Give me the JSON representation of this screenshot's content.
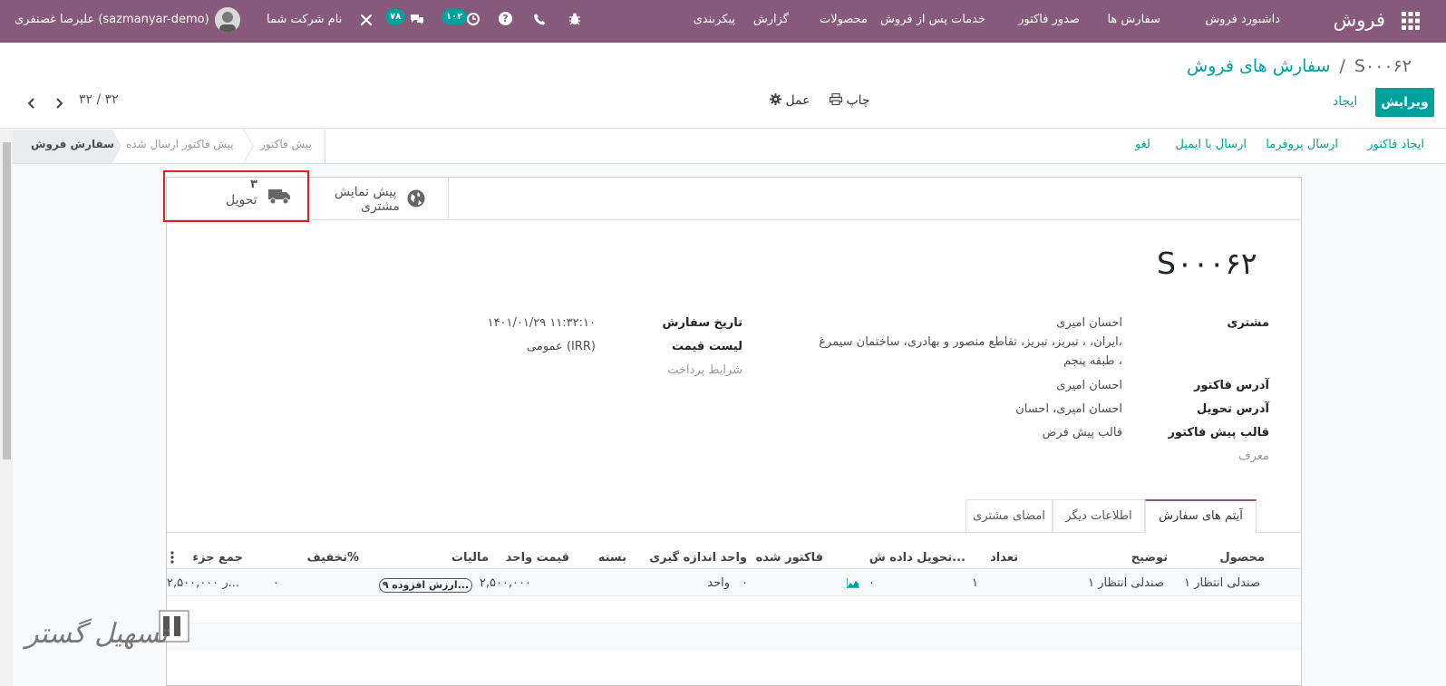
{
  "navbar": {
    "brand": "فروش",
    "menu": [
      "داشبورد فروش",
      "سفارش ها",
      "صدور فاکتور",
      "خدمات پس از فروش",
      "محصولات",
      "گزارش",
      "پیکربندی"
    ],
    "company": "نام شرکت شما",
    "user": "علیرضا غضنفری (sazmanyar-demo)",
    "messages_count": "۷۸",
    "activities_count": "۱۰۲",
    "help_icon": "?"
  },
  "breadcrumb": {
    "parent": "سفارش های فروش",
    "separator": "/",
    "current": "S۰۰۰۶۲"
  },
  "actions": {
    "edit": "ویرایش",
    "create": "ایجاد",
    "print": "چاپ",
    "action": "عمل"
  },
  "pager": {
    "text": "۳۲ / ۳۲"
  },
  "header_buttons": [
    "ایجاد فاکتور",
    "ارسال پروفرما",
    "ارسال با ایمیل",
    "لغو"
  ],
  "status_stages": [
    "سفارش فروش",
    "پیش فاکتور ارسال شده",
    "پیش فاکتور"
  ],
  "smart_buttons": {
    "delivery": {
      "count": "۳",
      "label": "تحویل"
    },
    "preview": {
      "line1": "پیش نمایش",
      "line2": "مشتری"
    }
  },
  "record": {
    "name": "S۰۰۰۶۲",
    "fields_right": {
      "customer_label": "مشتری",
      "customer_name": "احسان امیری",
      "customer_address_1": "ایران، ، تبریز، تبریز، تقاطع منصور و بهادری، ساختمان سیمرغ،",
      "customer_address_2": "طبقه پنجم ،",
      "invoice_address_label": "آدرس فاکتور",
      "invoice_address": "احسان امیری",
      "delivery_address_label": "آدرس تحویل",
      "delivery_address": "احسان امیری، احسان",
      "quote_template_label": "قالب پیش فاکتور",
      "quote_template": "قالب پیش فرض",
      "referrer_label": "معرف"
    },
    "fields_left": {
      "order_date_label": "تاریخ سفارش",
      "order_date": "۱۴۰۱/۰۱/۲۹ ۱۱:۳۲:۱۰",
      "pricelist_label": "لیست قیمت",
      "pricelist": "عمومی (IRR)",
      "payment_terms_label": "شرایط پرداخت"
    }
  },
  "tabs": [
    "آیتم های سفارش",
    "اطلاعات دیگر",
    "امضای مشتری"
  ],
  "order_lines": {
    "columns": [
      "محصول",
      "توضیح",
      "تعداد",
      "تحویل داده ش...",
      "فاکتور شده",
      "واحد اندازه گیری",
      "بسته",
      "قیمت واحد",
      "مالیات",
      "تخفیف%",
      "جمع جزء"
    ],
    "rows": [
      {
        "product": "صندلی انتظار ۱",
        "description": "صندلی انتظار ۱",
        "quantity": "۱",
        "delivered": "۰",
        "invoiced": "۰",
        "uom": "واحد",
        "package": "",
        "price_unit": "۲,۵۰۰,۰۰۰",
        "taxes": "ارزش افزوده ۹...",
        "discount": "۰",
        "subtotal": "۲,۵۰۰,۰۰۰ ر..."
      }
    ]
  },
  "watermark": {
    "text": "تسهیل گستر"
  },
  "colors": {
    "navbar": "#875a7b",
    "accent": "#00a09d",
    "highlight": "#e02020"
  }
}
